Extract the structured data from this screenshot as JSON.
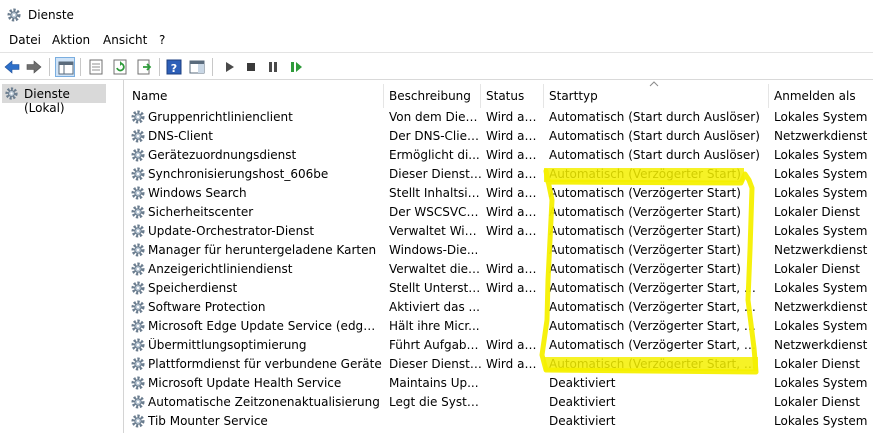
{
  "window": {
    "title": "Dienste"
  },
  "menu": {
    "items": [
      "Datei",
      "Aktion",
      "Ansicht",
      "?"
    ]
  },
  "tree": {
    "root_label": "Dienste (Lokal)"
  },
  "columns": {
    "name": "Name",
    "description": "Beschreibung",
    "status": "Status",
    "start_type": "Starttyp",
    "logon": "Anmelden als"
  },
  "services": [
    {
      "name": "Gruppenrichtlinienclient",
      "description": "Von dem Dien...",
      "status": "Wird au...",
      "start_type": "Automatisch (Start durch Auslöser)",
      "logon": "Lokales System"
    },
    {
      "name": "DNS-Client",
      "description": "Der DNS-Clien...",
      "status": "Wird au...",
      "start_type": "Automatisch (Start durch Auslöser)",
      "logon": "Netzwerkdienst"
    },
    {
      "name": "Gerätezuordnungsdienst",
      "description": "Ermöglicht di...",
      "status": "Wird au...",
      "start_type": "Automatisch (Start durch Auslöser)",
      "logon": "Lokales System"
    },
    {
      "name": "Synchronisierungshost_606be",
      "description": "Dieser Dienst s...",
      "status": "Wird au...",
      "start_type": "Automatisch (Verzögerter Start)",
      "logon": "Lokales System"
    },
    {
      "name": "Windows Search",
      "description": "Stellt Inhaltsin...",
      "status": "Wird au...",
      "start_type": "Automatisch (Verzögerter Start)",
      "logon": "Lokales System"
    },
    {
      "name": "Sicherheitscenter",
      "description": "Der WSCSVC-...",
      "status": "Wird au...",
      "start_type": "Automatisch (Verzögerter Start)",
      "logon": "Lokaler Dienst"
    },
    {
      "name": "Update-Orchestrator-Dienst",
      "description": "Verwaltet Win...",
      "status": "Wird au...",
      "start_type": "Automatisch (Verzögerter Start)",
      "logon": "Lokales System"
    },
    {
      "name": "Manager für heruntergeladene Karten",
      "description": "Windows-Die...",
      "status": "",
      "start_type": "Automatisch (Verzögerter Start)",
      "logon": "Netzwerkdienst"
    },
    {
      "name": "Anzeigerichtliniendienst",
      "description": "Verwaltet die ...",
      "status": "Wird au...",
      "start_type": "Automatisch (Verzögerter Start)",
      "logon": "Lokaler Dienst"
    },
    {
      "name": "Speicherdienst",
      "description": "Stellt Unterstü...",
      "status": "Wird au...",
      "start_type": "Automatisch (Verzögerter Start, Start d...",
      "logon": "Lokales System"
    },
    {
      "name": "Software Protection",
      "description": "Aktiviert das ...",
      "status": "",
      "start_type": "Automatisch (Verzögerter Start, Start d...",
      "logon": "Netzwerkdienst"
    },
    {
      "name": "Microsoft Edge Update Service (edgeupda...",
      "description": "Hält ihre Micr...",
      "status": "",
      "start_type": "Automatisch (Verzögerter Start, Start d...",
      "logon": "Lokales System"
    },
    {
      "name": "Übermittlungsoptimierung",
      "description": "Führt Aufgabe...",
      "status": "Wird au...",
      "start_type": "Automatisch (Verzögerter Start, Start d...",
      "logon": "Netzwerkdienst"
    },
    {
      "name": "Plattformdienst für verbundene Geräte",
      "description": "Dieser Dienst ...",
      "status": "Wird au...",
      "start_type": "Automatisch (Verzögerter Start, Start d...",
      "logon": "Lokaler Dienst"
    },
    {
      "name": "Microsoft Update Health Service",
      "description": "Maintains Up...",
      "status": "",
      "start_type": "Deaktiviert",
      "logon": "Lokales System"
    },
    {
      "name": "Automatische Zeitzonenaktualisierung",
      "description": "Legt die Syste...",
      "status": "",
      "start_type": "Deaktiviert",
      "logon": "Lokaler Dienst"
    },
    {
      "name": "Tib Mounter Service",
      "description": "",
      "status": "",
      "start_type": "Deaktiviert",
      "logon": "Lokales System"
    }
  ],
  "colors": {
    "highlight": "#f5f000",
    "selection": "#d9d9d9",
    "nav_arrow": "#2d6fc9"
  }
}
